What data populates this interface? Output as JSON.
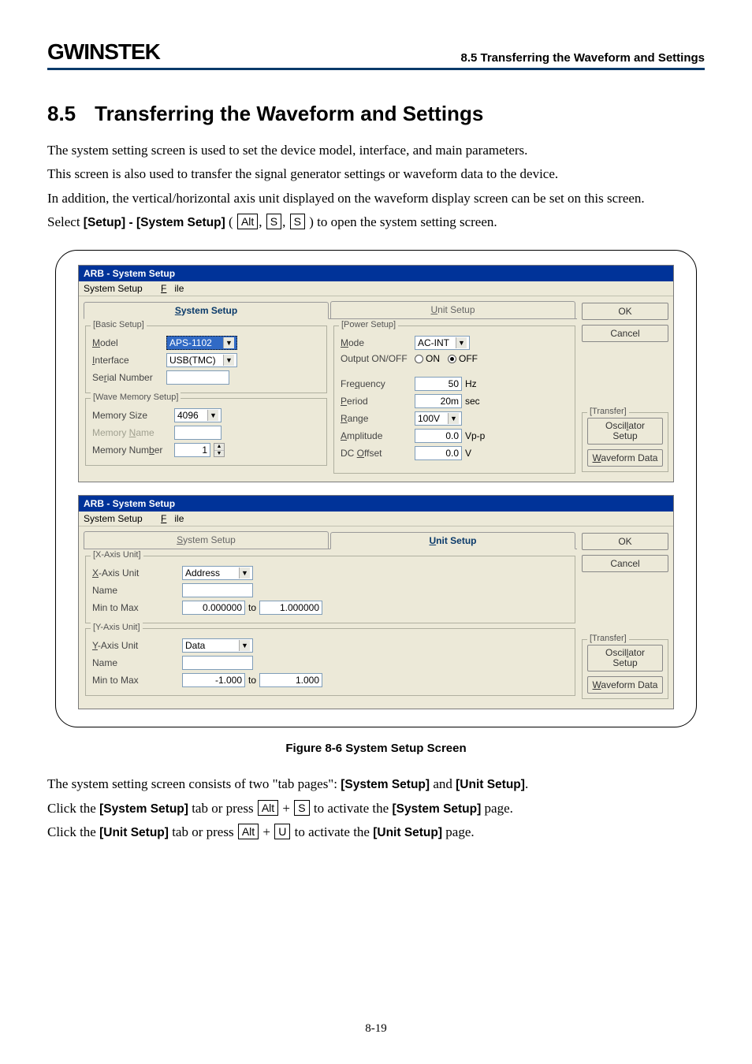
{
  "header": {
    "logo": "GWINSTEK",
    "right": "8.5 Transferring the Waveform and Settings"
  },
  "section": {
    "num": "8.5",
    "title": "Transferring the Waveform and Settings"
  },
  "paragraphs": {
    "p1": "The system setting screen is used to set the device model, interface, and main parameters.",
    "p2": "This screen is also used to transfer the signal generator settings or waveform data to the device.",
    "p3": "In addition, the vertical/horizontal axis unit displayed on the waveform display screen can be set on this screen.",
    "p4a": "Select ",
    "p4b": "[Setup] - [System Setup]",
    "p4c": " ( ",
    "p4d": " ) to open the system setting screen."
  },
  "keys": {
    "alt": "Alt",
    "s": "S",
    "u": "U"
  },
  "dialog1": {
    "title": "ARB - System Setup",
    "menu1": "System Setup",
    "menu2": "File",
    "tabs": {
      "system": "System Setup",
      "unit": "Unit Setup"
    },
    "basic": {
      "legend": "[Basic Setup]",
      "model_l": "Model",
      "model_v": "APS-1102",
      "iface_l": "Interface",
      "iface_v": "USB(TMC)",
      "serial_l": "Serial Number"
    },
    "wave": {
      "legend": "[Wave Memory Setup]",
      "size_l": "Memory Size",
      "size_v": "4096",
      "name_l": "Memory Name",
      "num_l": "Memory Number",
      "num_v": "1"
    },
    "power": {
      "legend": "[Power Setup]",
      "mode_l": "Mode",
      "mode_v": "AC-INT",
      "out_l": "Output ON/OFF",
      "on": "ON",
      "off": "OFF",
      "freq_l": "Frequency",
      "freq_v": "50",
      "freq_u": "Hz",
      "period_l": "Period",
      "period_v": "20m",
      "period_u": "sec",
      "range_l": "Range",
      "range_v": "100V",
      "amp_l": "Amplitude",
      "amp_v": "0.0",
      "amp_u": "Vp-p",
      "dco_l": "DC Offset",
      "dco_v": "0.0",
      "dco_u": "V"
    },
    "buttons": {
      "ok": "OK",
      "cancel": "Cancel",
      "transfer_legend": "[Transfer]",
      "osc": "Oscillator Setup",
      "wave": "Waveform Data"
    }
  },
  "dialog2": {
    "title": "ARB - System Setup",
    "x": {
      "legend": "[X-Axis Unit]",
      "unit_l": "X-Axis Unit",
      "unit_v": "Address",
      "name_l": "Name",
      "mm_l": "Min to Max",
      "min": "0.000000",
      "to": "to",
      "max": "1.000000"
    },
    "y": {
      "legend": "[Y-Axis Unit]",
      "unit_l": "Y-Axis Unit",
      "unit_v": "Data",
      "name_l": "Name",
      "mm_l": "Min to Max",
      "min": "-1.000",
      "to": "to",
      "max": "1.000"
    }
  },
  "figcaption": "Figure 8-6 System Setup Screen",
  "tail": {
    "t1a": "The system setting screen consists of two \"tab pages\": ",
    "t1b": "[System Setup]",
    "t1c": " and ",
    "t1d": "[Unit Setup]",
    "t1e": ".",
    "t2a": "Click the ",
    "t2b": "[System Setup]",
    "t2c": " tab or press ",
    "t2d": " to activate the ",
    "t2e": "[System Setup]",
    "t2f": " page.",
    "t3a": "Click the ",
    "t3b": "[Unit Setup]",
    "t3c": " tab or press ",
    "t3d": "  to activate the ",
    "t3e": "[Unit Setup]",
    "t3f": " page."
  },
  "pagenum": "8-19"
}
